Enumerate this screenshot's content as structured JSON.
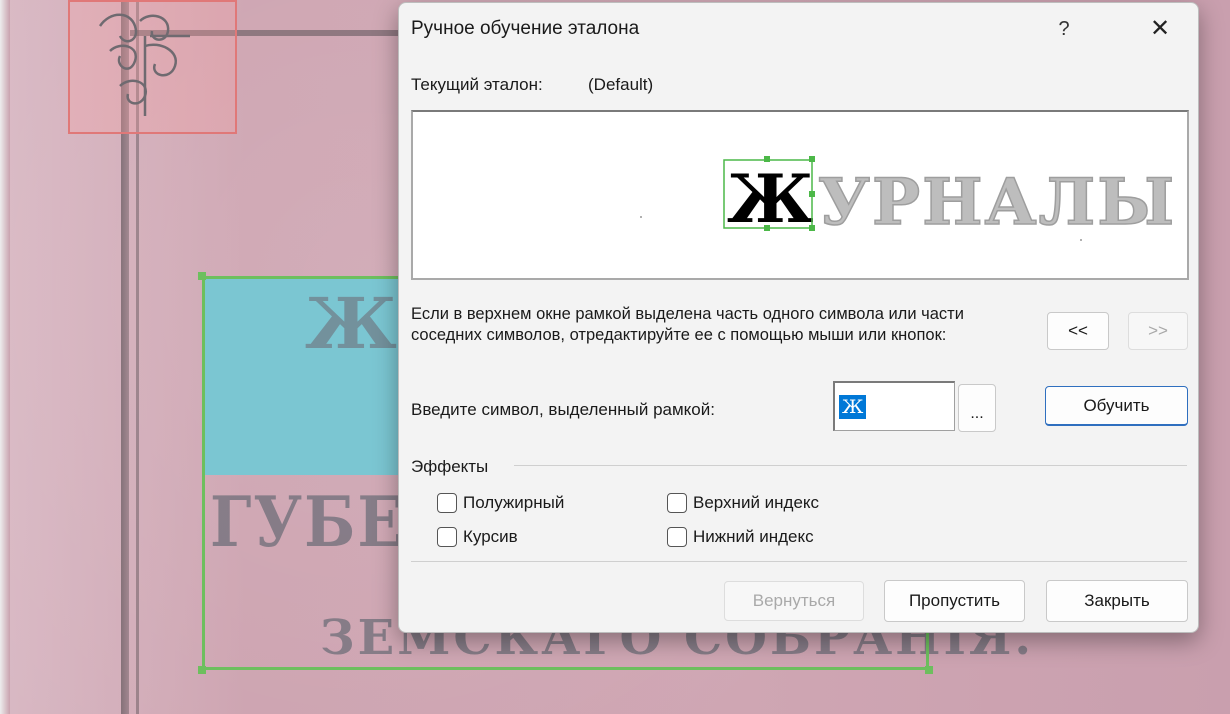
{
  "dialog": {
    "title": "Ручное обучение эталона",
    "help_label": "?",
    "close_label": "✕",
    "current_label": "Текущий эталон:",
    "current_value": "(Default)",
    "preview_glyph": "Ж",
    "preview_text": "УРНАЛЫ",
    "info_text": "Если в верхнем окне рамкой выделена часть одного символа или части соседних символов, отредактируйте ее с помощью мыши или кнопок:",
    "prev_label": "<<",
    "next_label": ">>",
    "enter_label": "Введите символ, выделенный рамкой:",
    "char_value": "Ж",
    "dots_label": "...",
    "train_label": "Обучить",
    "effects_label": "Эффекты",
    "effects": {
      "bold": "Полужирный",
      "italic": "Курсив",
      "superscript": "Верхний индекс",
      "subscript": "Нижний индекс"
    },
    "back_label": "Вернуться",
    "skip_label": "Пропустить",
    "close_button_label": "Закрыть"
  },
  "background": {
    "title_line_1": "ГУБЕРНСI",
    "title_line_2": "ЗЕМСКАГО   СОБРАНIЯ.",
    "glyph": "Ж"
  },
  "colors": {
    "accent": "#0078d7",
    "selection_green": "#6dbf5e",
    "ornament_red": "#e07878",
    "cyan_block": "#7bc6d2"
  }
}
